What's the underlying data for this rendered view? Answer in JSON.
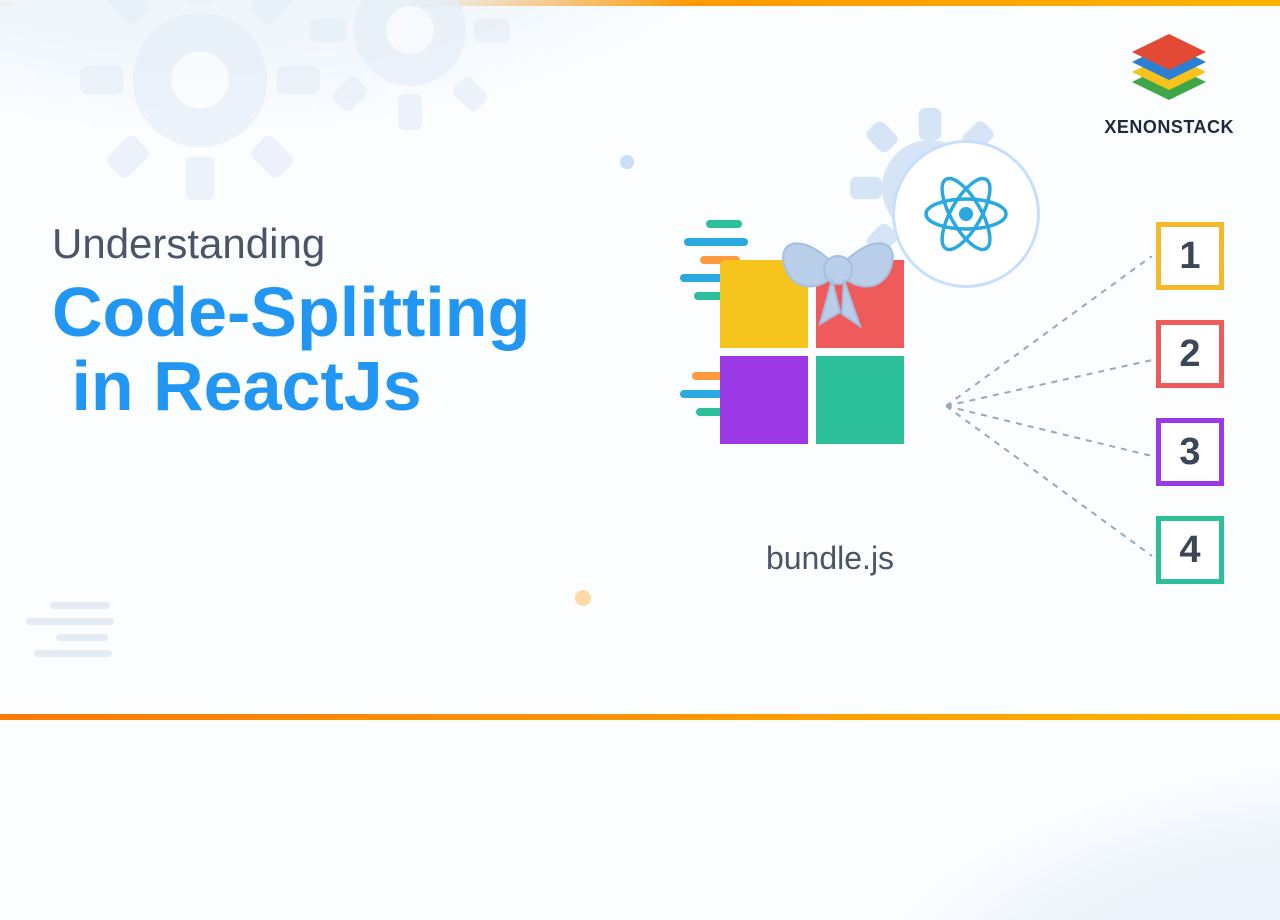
{
  "brand": {
    "name": "XENONSTACK"
  },
  "headline": {
    "small": "Understanding",
    "line1": "Code-Splitting",
    "line2": "in ReactJs"
  },
  "bundle_label": "bundle.js",
  "chunks": [
    {
      "label": "1",
      "color_name": "yellow"
    },
    {
      "label": "2",
      "color_name": "red"
    },
    {
      "label": "3",
      "color_name": "purple"
    },
    {
      "label": "4",
      "color_name": "green"
    }
  ],
  "icons": {
    "react": "react-icon",
    "gear_bg": "gear-icon",
    "bow": "ribbon-bow-icon",
    "stack": "stacked-layers-icon"
  },
  "colors": {
    "accent_blue": "#2196f3",
    "yellow": "#f5c51d",
    "red": "#ef5a5a",
    "purple": "#9b39e6",
    "green": "#2bc09a",
    "text_muted": "#4a5568"
  }
}
